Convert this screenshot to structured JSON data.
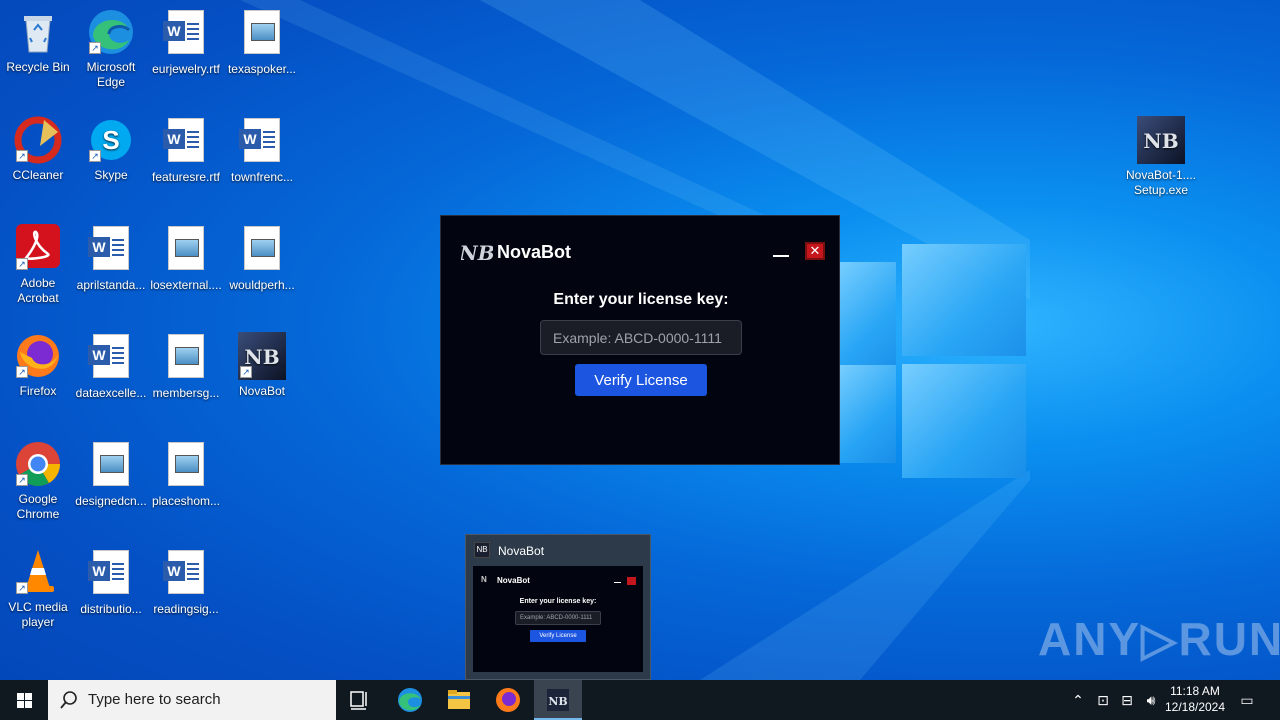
{
  "desktop": {
    "icons": [
      {
        "label": "Recycle Bin"
      },
      {
        "label": "Microsoft Edge"
      },
      {
        "label": "eurjewelry.rtf"
      },
      {
        "label": "texaspoker..."
      },
      {
        "label": "CCleaner"
      },
      {
        "label": "Skype"
      },
      {
        "label": "featuresre.rtf"
      },
      {
        "label": "townfrenc..."
      },
      {
        "label": "Adobe Acrobat"
      },
      {
        "label": "aprilstanda..."
      },
      {
        "label": "losexternal...."
      },
      {
        "label": "wouldperh..."
      },
      {
        "label": "Firefox"
      },
      {
        "label": "dataexcelle..."
      },
      {
        "label": "membersg..."
      },
      {
        "label": "NovaBot"
      },
      {
        "label": "Google Chrome"
      },
      {
        "label": "designedcn..."
      },
      {
        "label": "placeshom..."
      },
      {
        "label": "VLC media player"
      },
      {
        "label": "distributio..."
      },
      {
        "label": "readingsig..."
      },
      {
        "label": "NovaBot-1.... Setup.exe"
      }
    ]
  },
  "dialog": {
    "logo_text": "NB",
    "title": "NovaBot",
    "prompt": "Enter your license key:",
    "input_placeholder": "Example: ABCD-0000-1111",
    "button_label": "Verify License",
    "close_glyph": "✕"
  },
  "preview": {
    "title": "NovaBot",
    "mini_title": "NovaBot",
    "mini_prompt": "Enter your license key:",
    "mini_placeholder": "Example: ABCD-0000-1111",
    "mini_button": "Verify License"
  },
  "watermark": "ANY▷RUN",
  "taskbar": {
    "search_placeholder": "Type here to search",
    "time": "11:18 AM",
    "date": "12/18/2024"
  },
  "colors": {
    "accent_button": "#1c55e0",
    "close_red": "#c4161c",
    "dialog_bg": "#02050f"
  }
}
